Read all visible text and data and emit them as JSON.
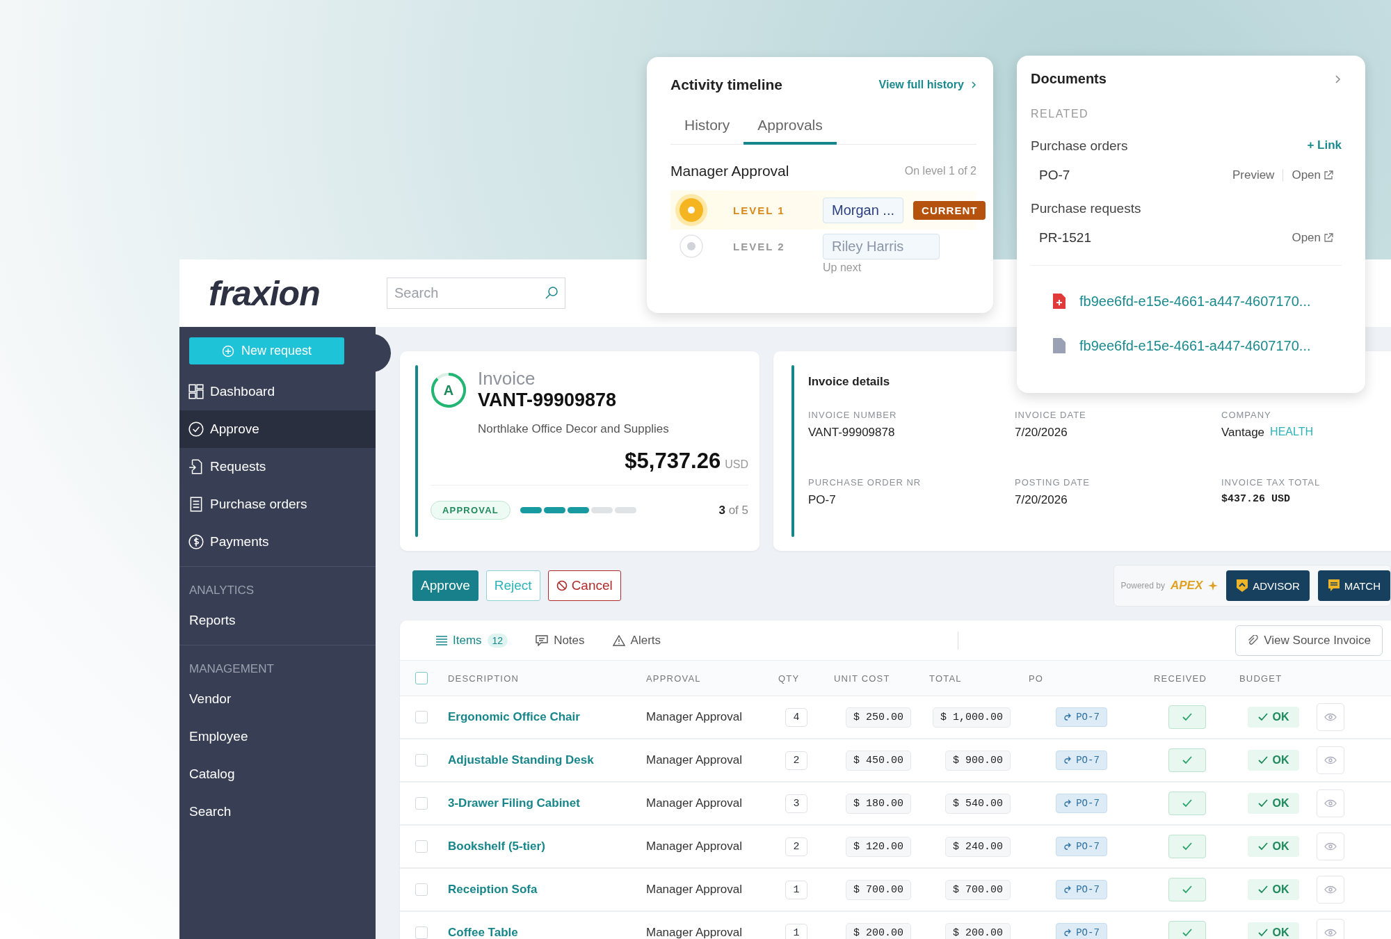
{
  "brand": {
    "logo": "fraxion"
  },
  "search": {
    "placeholder": "Search"
  },
  "sidebar": {
    "new_request": "New request",
    "nav": [
      {
        "label": "Dashboard",
        "selected": false
      },
      {
        "label": "Approve",
        "selected": true
      },
      {
        "label": "Requests",
        "selected": false
      },
      {
        "label": "Purchase orders",
        "selected": false
      },
      {
        "label": "Payments",
        "selected": false
      }
    ],
    "sections": [
      {
        "heading": "ANALYTICS",
        "items": [
          {
            "label": "Reports",
            "selected": false
          }
        ]
      },
      {
        "heading": "MANAGEMENT",
        "items": [
          {
            "label": "Vendor",
            "selected": false
          },
          {
            "label": "Employee",
            "selected": false
          },
          {
            "label": "Catalog",
            "selected": false
          },
          {
            "label": "Search",
            "selected": false
          }
        ]
      }
    ]
  },
  "invoice": {
    "avatar": "A",
    "type": "Invoice",
    "number": "VANT-99909878",
    "vendor": "Northlake Office Decor and Supplies",
    "amount": "$5,737.26",
    "currency": "USD",
    "stage": "APPROVAL",
    "steps": [
      {
        "done": true
      },
      {
        "done": true
      },
      {
        "done": true
      },
      {
        "done": false
      },
      {
        "done": false
      }
    ],
    "step_count": "**3** of 5"
  },
  "details": {
    "title": "Invoice details",
    "fields": [
      {
        "label": "INVOICE NUMBER",
        "value": "VANT-99909878"
      },
      {
        "label": "INVOICE DATE",
        "value": "7/20/2026"
      },
      {
        "label": "COMPANY",
        "value": "Vantage",
        "tag": "HEALTH"
      },
      {
        "label": "PURCHASE ORDER NR",
        "value": "PO-7"
      },
      {
        "label": "POSTING DATE",
        "value": "7/20/2026"
      },
      {
        "label": "INVOICE TAX TOTAL",
        "value": "$437.26 USD",
        "kind": "mono"
      }
    ]
  },
  "actions": [
    {
      "label": "Approve",
      "kind": "primary"
    },
    {
      "label": "Reject",
      "kind": "outline"
    },
    {
      "label": "Cancel",
      "kind": "danger"
    }
  ],
  "apex": {
    "powered_by": "Powered by",
    "brand": "APEX",
    "buttons": [
      "ADVISOR",
      "MATCH"
    ]
  },
  "table": {
    "tabs": [
      {
        "label": "Items",
        "count": "12",
        "selected": true
      },
      {
        "label": "Notes",
        "selected": false
      },
      {
        "label": "Alerts",
        "selected": false
      }
    ],
    "source_button": "View Source Invoice",
    "header_checked": false,
    "columns": [
      "DESCRIPTION",
      "APPROVAL",
      "QTY",
      "UNIT COST",
      "TOTAL",
      "PO",
      "RECEIVED",
      "BUDGET"
    ],
    "rows": [
      {
        "checked": false,
        "description": "Ergonomic Office Chair",
        "approval": "Manager Approval",
        "qty": "4",
        "unit_cost": "$ 250.00",
        "total": "$ 1,000.00",
        "po": "PO-7",
        "received": true,
        "budget": "OK"
      },
      {
        "checked": false,
        "description": "Adjustable Standing Desk",
        "approval": "Manager Approval",
        "qty": "2",
        "unit_cost": "$ 450.00",
        "total": "$ 900.00",
        "po": "PO-7",
        "received": true,
        "budget": "OK"
      },
      {
        "checked": false,
        "description": "3-Drawer Filing Cabinet",
        "approval": "Manager Approval",
        "qty": "3",
        "unit_cost": "$ 180.00",
        "total": "$ 540.00",
        "po": "PO-7",
        "received": true,
        "budget": "OK"
      },
      {
        "checked": false,
        "description": "Bookshelf (5-tier)",
        "approval": "Manager Approval",
        "qty": "2",
        "unit_cost": "$ 120.00",
        "total": "$ 240.00",
        "po": "PO-7",
        "received": true,
        "budget": "OK"
      },
      {
        "checked": false,
        "description": "Receiption Sofa",
        "approval": "Manager Approval",
        "qty": "1",
        "unit_cost": "$ 700.00",
        "total": "$ 700.00",
        "po": "PO-7",
        "received": true,
        "budget": "OK"
      },
      {
        "checked": false,
        "description": "Coffee Table",
        "approval": "Manager Approval",
        "qty": "1",
        "unit_cost": "$ 200.00",
        "total": "$ 200.00",
        "po": "PO-7",
        "received": true,
        "budget": "OK"
      }
    ]
  },
  "activity": {
    "title": "Activity timeline",
    "link": "View full history",
    "tabs": [
      {
        "label": "History",
        "selected": false
      },
      {
        "label": "Approvals",
        "selected": true
      }
    ],
    "step_name": "Manager Approval",
    "progress": "On level 1 of 2",
    "levels": [
      {
        "label": "LEVEL 1",
        "approver": "Morgan ...",
        "current": true,
        "badge": "CURRENT"
      },
      {
        "label": "LEVEL 2",
        "approver": "Riley Harris",
        "current": false,
        "note": "Up next"
      }
    ]
  },
  "documents": {
    "title": "Documents",
    "section": "RELATED",
    "groups": [
      {
        "title": "Purchase orders",
        "action": "+ Link",
        "items": [
          {
            "name": "PO-7",
            "preview": "Preview",
            "open": "Open"
          }
        ]
      },
      {
        "title": "Purchase requests",
        "items": [
          {
            "name": "PR-1521",
            "open": "Open"
          }
        ]
      }
    ],
    "files": [
      {
        "name": "fb9ee6fd-e15e-4661-a447-4607170...",
        "kind": "pdf"
      },
      {
        "name": "fb9ee6fd-e15e-4661-a447-4607170...",
        "kind": "generic"
      }
    ]
  }
}
